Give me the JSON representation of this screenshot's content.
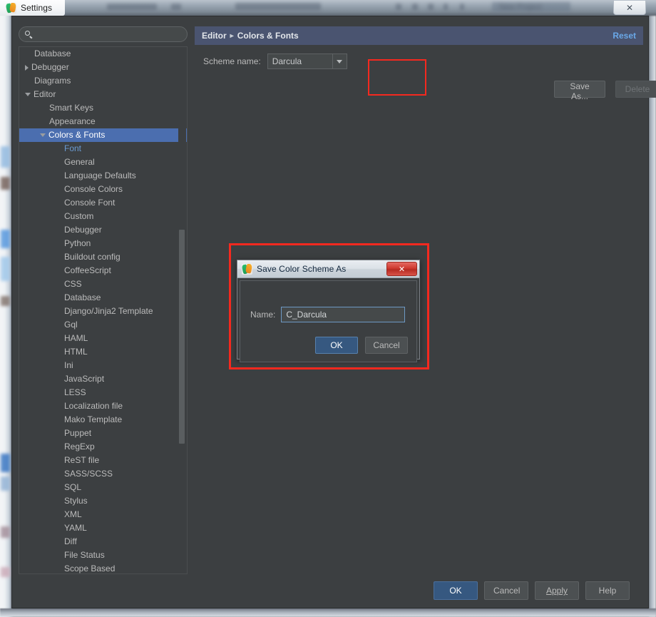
{
  "window": {
    "title": "Settings",
    "app_icon": "pycharm-icon",
    "close_label": "✕"
  },
  "search": {
    "value": "",
    "placeholder": "",
    "icon": "search-icon"
  },
  "tree": {
    "items": [
      {
        "label": "Database",
        "indent": 0,
        "twisty": "none",
        "state": "normal"
      },
      {
        "label": "Debugger",
        "indent": 0,
        "twisty": "collapsed",
        "state": "normal"
      },
      {
        "label": "Diagrams",
        "indent": 0,
        "twisty": "none",
        "state": "normal"
      },
      {
        "label": "Editor",
        "indent": 0,
        "twisty": "expanded",
        "state": "normal"
      },
      {
        "label": "Smart Keys",
        "indent": 1,
        "twisty": "none",
        "state": "normal"
      },
      {
        "label": "Appearance",
        "indent": 1,
        "twisty": "none",
        "state": "normal"
      },
      {
        "label": "Colors & Fonts",
        "indent": 1,
        "twisty": "expanded",
        "state": "selected"
      },
      {
        "label": "Font",
        "indent": 2,
        "twisty": "none",
        "state": "accent"
      },
      {
        "label": "General",
        "indent": 2,
        "twisty": "none",
        "state": "normal"
      },
      {
        "label": "Language Defaults",
        "indent": 2,
        "twisty": "none",
        "state": "normal"
      },
      {
        "label": "Console Colors",
        "indent": 2,
        "twisty": "none",
        "state": "normal"
      },
      {
        "label": "Console Font",
        "indent": 2,
        "twisty": "none",
        "state": "normal"
      },
      {
        "label": "Custom",
        "indent": 2,
        "twisty": "none",
        "state": "normal"
      },
      {
        "label": "Debugger",
        "indent": 2,
        "twisty": "none",
        "state": "normal"
      },
      {
        "label": "Python",
        "indent": 2,
        "twisty": "none",
        "state": "normal"
      },
      {
        "label": "Buildout config",
        "indent": 2,
        "twisty": "none",
        "state": "normal"
      },
      {
        "label": "CoffeeScript",
        "indent": 2,
        "twisty": "none",
        "state": "normal"
      },
      {
        "label": "CSS",
        "indent": 2,
        "twisty": "none",
        "state": "normal"
      },
      {
        "label": "Database",
        "indent": 2,
        "twisty": "none",
        "state": "normal"
      },
      {
        "label": "Django/Jinja2 Template",
        "indent": 2,
        "twisty": "none",
        "state": "normal"
      },
      {
        "label": "Gql",
        "indent": 2,
        "twisty": "none",
        "state": "normal"
      },
      {
        "label": "HAML",
        "indent": 2,
        "twisty": "none",
        "state": "normal"
      },
      {
        "label": "HTML",
        "indent": 2,
        "twisty": "none",
        "state": "normal"
      },
      {
        "label": "Ini",
        "indent": 2,
        "twisty": "none",
        "state": "normal"
      },
      {
        "label": "JavaScript",
        "indent": 2,
        "twisty": "none",
        "state": "normal"
      },
      {
        "label": "LESS",
        "indent": 2,
        "twisty": "none",
        "state": "normal"
      },
      {
        "label": "Localization file",
        "indent": 2,
        "twisty": "none",
        "state": "normal"
      },
      {
        "label": "Mako Template",
        "indent": 2,
        "twisty": "none",
        "state": "normal"
      },
      {
        "label": "Puppet",
        "indent": 2,
        "twisty": "none",
        "state": "normal"
      },
      {
        "label": "RegExp",
        "indent": 2,
        "twisty": "none",
        "state": "normal"
      },
      {
        "label": "ReST file",
        "indent": 2,
        "twisty": "none",
        "state": "normal"
      },
      {
        "label": "SASS/SCSS",
        "indent": 2,
        "twisty": "none",
        "state": "normal"
      },
      {
        "label": "SQL",
        "indent": 2,
        "twisty": "none",
        "state": "normal"
      },
      {
        "label": "Stylus",
        "indent": 2,
        "twisty": "none",
        "state": "normal"
      },
      {
        "label": "XML",
        "indent": 2,
        "twisty": "none",
        "state": "normal"
      },
      {
        "label": "YAML",
        "indent": 2,
        "twisty": "none",
        "state": "normal"
      },
      {
        "label": "Diff",
        "indent": 2,
        "twisty": "none",
        "state": "normal"
      },
      {
        "label": "File Status",
        "indent": 2,
        "twisty": "none",
        "state": "normal"
      },
      {
        "label": "Scope Based",
        "indent": 2,
        "twisty": "none",
        "state": "normal"
      }
    ]
  },
  "breadcrumb": {
    "parts": [
      "Editor",
      "Colors & Fonts"
    ],
    "separator": "▸",
    "reset_label": "Reset"
  },
  "scheme": {
    "label": "Scheme name:",
    "selected": "Darcula",
    "options": [
      "Darcula"
    ],
    "save_as_label": "Save As...",
    "delete_label": "Delete",
    "delete_disabled": true
  },
  "footer": {
    "ok_label": "OK",
    "cancel_label": "Cancel",
    "apply_label": "Apply",
    "help_label": "Help"
  },
  "dialog": {
    "title": "Save Color Scheme As",
    "icon": "pycharm-icon",
    "close_label": "✕",
    "name_label": "Name:",
    "name_value": "C_Darcula",
    "ok_label": "OK",
    "cancel_label": "Cancel"
  },
  "colors": {
    "accent_blue": "#4b6eaf",
    "link_blue": "#6aa8e8",
    "highlight_red": "#f5291f",
    "panel_bg": "#3c3f41",
    "primary_button": "#365880"
  }
}
